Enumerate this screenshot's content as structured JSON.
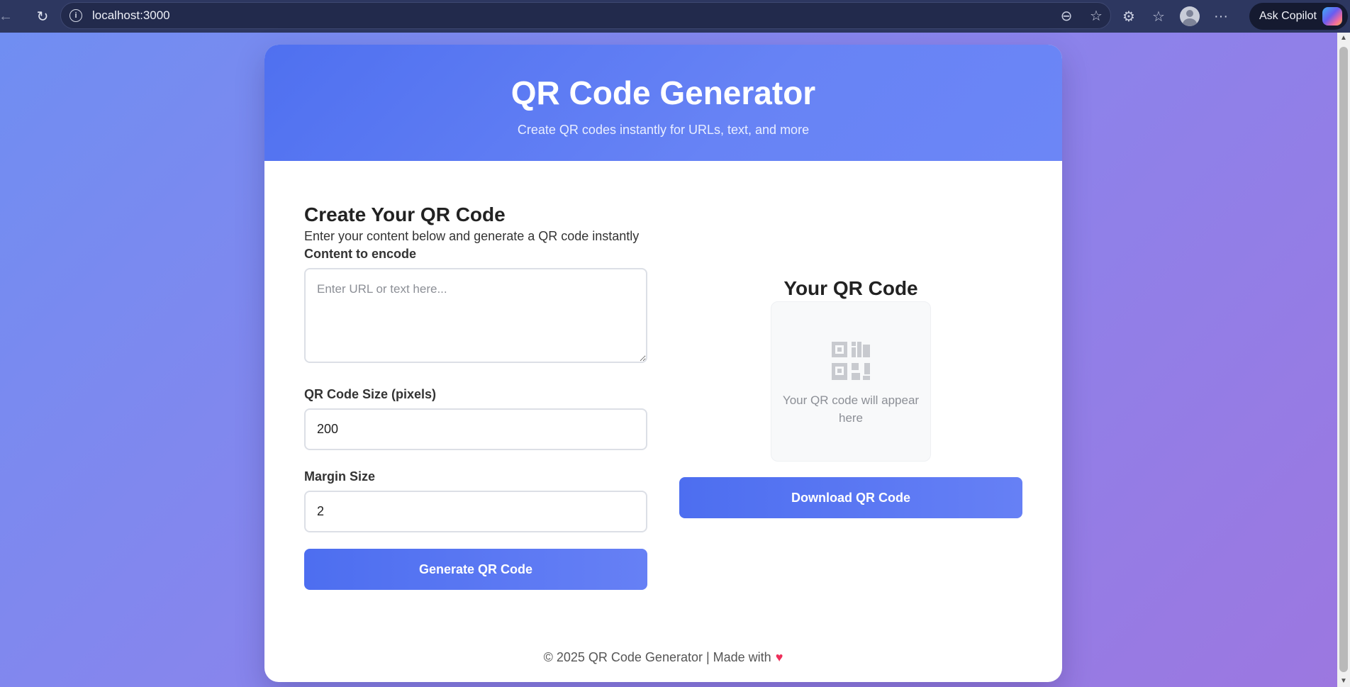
{
  "browser": {
    "url": "localhost:3000",
    "copilot_label": "Ask Copilot",
    "back_glyph": "←",
    "reload_glyph": "↻",
    "info_glyph": "i",
    "zoom_glyph": "⊖",
    "star_glyph": "☆",
    "extensions_glyph": "⚙",
    "favorites_glyph": "☆",
    "more_glyph": "···"
  },
  "header": {
    "title": "QR Code Generator",
    "subtitle": "Create QR codes instantly for URLs, text, and more"
  },
  "form": {
    "section_title": "Create Your QR Code",
    "section_description": "Enter your content below and generate a QR code instantly",
    "content_label": "Content to encode",
    "content_placeholder": "Enter URL or text here...",
    "content_value": "",
    "size_label": "QR Code Size (pixels)",
    "size_value": "200",
    "margin_label": "Margin Size",
    "margin_value": "2",
    "generate_label": "Generate QR Code"
  },
  "preview": {
    "title": "Your QR Code",
    "placeholder": "Your QR code will appear here",
    "download_label": "Download QR Code",
    "icon": "qr-code-icon"
  },
  "footer": {
    "text": "© 2025 QR Code Generator | Made with",
    "heart": "♥"
  },
  "colors": {
    "accent": "#4f70f0",
    "background_start": "#6f8ef2",
    "background_end": "#9c77e0",
    "heart": "#ee2f5a"
  }
}
